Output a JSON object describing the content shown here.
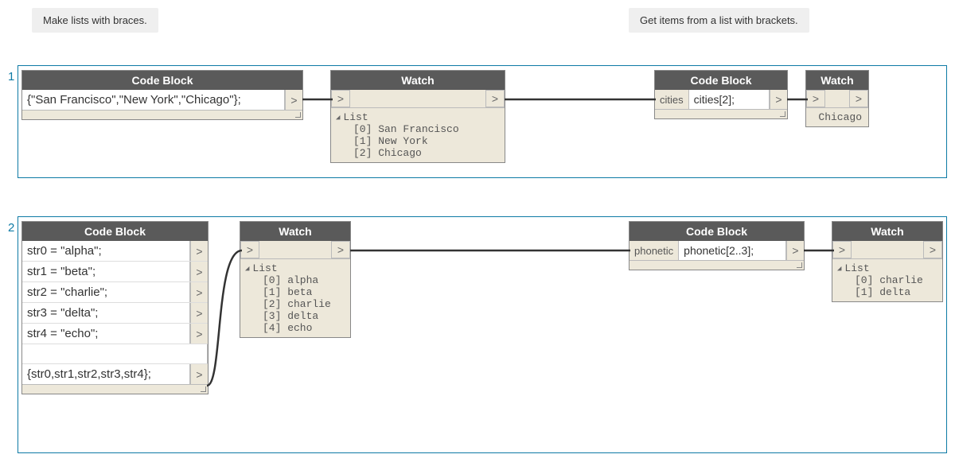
{
  "callouts": {
    "left": "Make lists with braces.",
    "right": "Get items from a list with brackets."
  },
  "section_labels": {
    "one": "1",
    "two": "2"
  },
  "node_titles": {
    "code_block": "Code Block",
    "watch": "Watch"
  },
  "port_glyph": ">",
  "s1": {
    "code1": "{\"San Francisco\",\"New York\",\"Chicago\"};",
    "code2_input": "cities",
    "code2": "cities[2];",
    "watch1": {
      "header": "List",
      "items": [
        "[0] San Francisco",
        "[1] New York",
        "[2] Chicago"
      ]
    },
    "watch2": "Chicago"
  },
  "s2": {
    "code_lines": [
      "str0 = \"alpha\";",
      "str1 = \"beta\";",
      "str2 = \"charlie\";",
      "str3 = \"delta\";",
      "str4 = \"echo\";",
      "",
      "{str0,str1,str2,str3,str4};"
    ],
    "watch1": {
      "header": "List",
      "items": [
        "[0] alpha",
        "[1] beta",
        "[2] charlie",
        "[3] delta",
        "[4] echo"
      ]
    },
    "code2_input": "phonetic",
    "code2": "phonetic[2..3];",
    "watch2": {
      "header": "List",
      "items": [
        "[0] charlie",
        "[1] delta"
      ]
    }
  }
}
